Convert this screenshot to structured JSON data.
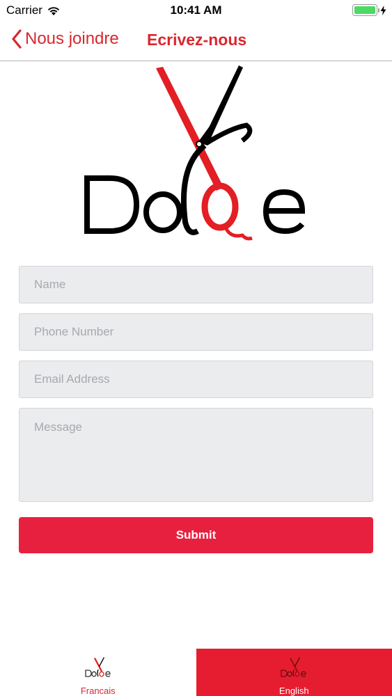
{
  "status_bar": {
    "carrier": "Carrier",
    "time": "10:41 AM",
    "battery_level": 1.0,
    "icons": [
      "wifi-icon",
      "battery-icon",
      "charging-bolt-icon"
    ]
  },
  "nav": {
    "back_label": "Nous joindre",
    "title": "Ecrivez-nous",
    "back_icon": "chevron-left-icon"
  },
  "logo": {
    "wordmark": "Dolce",
    "icon": "scissors-logo"
  },
  "form": {
    "name_placeholder": "Name",
    "phone_placeholder": "Phone Number",
    "email_placeholder": "Email Address",
    "message_placeholder": "Message",
    "submit_label": "Submit"
  },
  "tabs": [
    {
      "label": "Francais",
      "active": false
    },
    {
      "label": "English",
      "active": true
    }
  ],
  "colors": {
    "accent": "#d9272e",
    "button": "#e8203f",
    "active_tab": "#e61d30",
    "field_bg": "#eaecee"
  }
}
